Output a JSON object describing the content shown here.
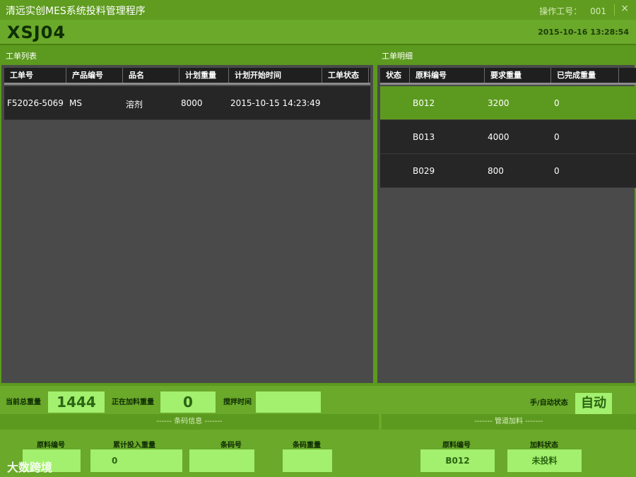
{
  "window": {
    "title": "清远实创MES系统投料管理程序",
    "operator_label": "操作工号：",
    "operator_no": "001",
    "close_glyph": "×"
  },
  "header": {
    "station": "XSJ04",
    "datetime": "2015-10-16 13:28:54"
  },
  "work_order_list": {
    "title": "工单列表",
    "columns": [
      "工单号",
      "产品编号",
      "品名",
      "计划重量",
      "计划开始时间",
      "工单状态"
    ],
    "rows": [
      [
        "F52026-5069",
        "MS",
        "溶剂",
        "8000",
        "2015-10-15 14:23:49",
        ""
      ]
    ]
  },
  "work_order_detail": {
    "title": "工单明细",
    "columns": [
      "状态",
      "原料编号",
      "要求重量",
      "已完成重量"
    ],
    "rows": [
      [
        "",
        "B012",
        "3200",
        "0"
      ],
      [
        "",
        "B013",
        "4000",
        "0"
      ],
      [
        "",
        "B029",
        "800",
        "0"
      ]
    ],
    "selected_row": 0
  },
  "status": {
    "total_weight_label": "当前总重量",
    "total_weight": "1444",
    "adding_weight_label": "正在加料重量",
    "adding_weight": "0",
    "stir_time_label": "搅拌时间",
    "stir_time": "",
    "mode_label": "手/自动状态",
    "mode": "自动"
  },
  "barcode": {
    "section_title": "------ 条码信息 -------",
    "material_no_label": "原料编号",
    "material_no": "",
    "cumulative_label": "累计投入重量",
    "cumulative": "0",
    "barcode_label": "条码号",
    "barcode": "",
    "barcode_weight_label": "条码重量",
    "barcode_weight": ""
  },
  "pipeline": {
    "section_title": "------- 管道加料 -------",
    "material_no_label": "原料编号",
    "material_no": "B012",
    "state_label": "加料状态",
    "state": "未投料"
  },
  "watermark": "大数跨境",
  "colors": {
    "accent": "#5c9a1f",
    "header": "#6aa92a",
    "value_box": "#a3ef6e",
    "grid_dark": "#262626",
    "panel_bg": "#4a4a4a"
  }
}
